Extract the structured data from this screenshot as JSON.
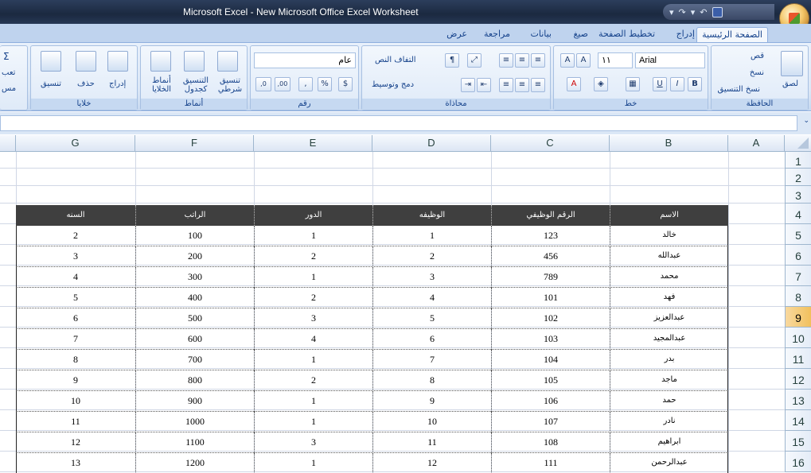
{
  "window": {
    "title": "Microsoft Excel - New Microsoft Office Excel Worksheet"
  },
  "tabs": [
    "الصفحة الرئيسية",
    "إدراج",
    "تخطيط الصفحة",
    "صيغ",
    "بيانات",
    "مراجعة",
    "عرض"
  ],
  "ribbon": {
    "clipboard": {
      "label": "الحافظة",
      "paste": "لصق",
      "cut": "قص",
      "copy": "نسخ",
      "format_painter": "نسخ التنسيق"
    },
    "font": {
      "label": "خط",
      "font_name": "Arial",
      "font_size": "١١",
      "bold": "B",
      "italic": "I",
      "underline": "U"
    },
    "alignment": {
      "label": "محاذاة",
      "wrap_text": "التفاف النص",
      "merge_center": "دمج وتوسيط"
    },
    "number": {
      "label": "رقم",
      "format": "عام",
      "percent": "%",
      "comma": ",",
      "inc_decimal": ",00",
      "dec_decimal": ",0"
    },
    "styles": {
      "label": "أنماط",
      "conditional": "تنسيق شرطي",
      "as_table": "التنسيق كجدول",
      "cell_styles": "أنماط الخلايا"
    },
    "cells": {
      "label": "خلايا",
      "insert": "إدراج",
      "delete": "حذف",
      "format": "تنسيق"
    },
    "editing": {
      "sum": "Σ",
      "fill": "تعب",
      "clear": "مس"
    }
  },
  "grid": {
    "columns": [
      "A",
      "B",
      "C",
      "D",
      "E",
      "F",
      "G"
    ],
    "rows": [
      "1",
      "2",
      "3",
      "4",
      "5",
      "6",
      "7",
      "8",
      "9",
      "10",
      "11",
      "12",
      "13",
      "14",
      "15",
      "16"
    ],
    "selected_row": "9"
  },
  "table": {
    "headers": [
      "الاسم",
      "الرقم الوظيفي",
      "الوظيفه",
      "الدور",
      "الراتب",
      "السنه"
    ],
    "rows": [
      [
        "خالد",
        "123",
        "1",
        "1",
        "100",
        "2"
      ],
      [
        "عبدالله",
        "456",
        "2",
        "2",
        "200",
        "3"
      ],
      [
        "محمد",
        "789",
        "3",
        "1",
        "300",
        "4"
      ],
      [
        "فهد",
        "101",
        "4",
        "2",
        "400",
        "5"
      ],
      [
        "عبدالعزيز",
        "102",
        "5",
        "3",
        "500",
        "6"
      ],
      [
        "عبدالمجيد",
        "103",
        "6",
        "4",
        "600",
        "7"
      ],
      [
        "بدر",
        "104",
        "7",
        "1",
        "700",
        "8"
      ],
      [
        "ماجد",
        "105",
        "8",
        "2",
        "800",
        "9"
      ],
      [
        "حمد",
        "106",
        "9",
        "1",
        "900",
        "10"
      ],
      [
        "نادر",
        "107",
        "10",
        "1",
        "1000",
        "11"
      ],
      [
        "ابراهيم",
        "108",
        "11",
        "3",
        "1100",
        "12"
      ],
      [
        "عبدالرحمن",
        "111",
        "12",
        "1",
        "1200",
        "13"
      ]
    ]
  }
}
